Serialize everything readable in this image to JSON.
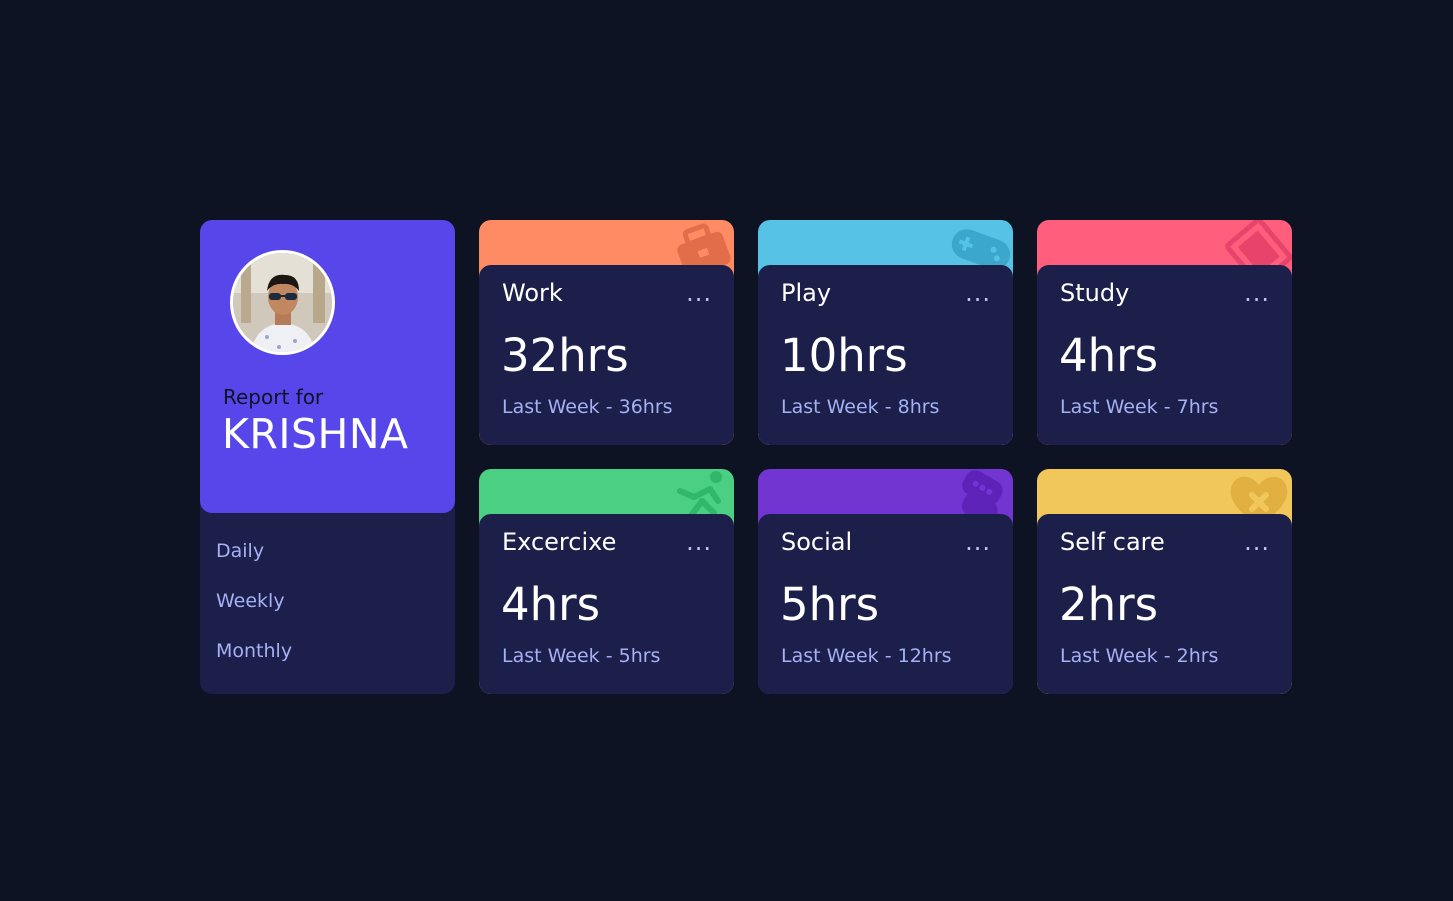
{
  "profile": {
    "report_label": "Report for",
    "name": "KRISHNA",
    "periods": [
      {
        "label": "Daily"
      },
      {
        "label": "Weekly"
      },
      {
        "label": "Monthly"
      }
    ]
  },
  "cards": [
    {
      "title": "Work",
      "current": "32hrs",
      "previous": "Last Week - 36hrs",
      "menu": "...",
      "color": "#ff8b64",
      "icon": "briefcase-icon"
    },
    {
      "title": "Play",
      "current": "10hrs",
      "previous": "Last Week - 8hrs",
      "menu": "...",
      "color": "#55c2e6",
      "icon": "gamepad-icon"
    },
    {
      "title": "Study",
      "current": "4hrs",
      "previous": "Last Week - 7hrs",
      "menu": "...",
      "color": "#ff5e7d",
      "icon": "book-icon"
    },
    {
      "title": "Excercixe",
      "current": "4hrs",
      "previous": "Last Week - 5hrs",
      "menu": "...",
      "color": "#4bcf82",
      "icon": "running-icon"
    },
    {
      "title": "Social",
      "current": "5hrs",
      "previous": "Last Week - 12hrs",
      "menu": "...",
      "color": "#7335d2",
      "icon": "chat-icon"
    },
    {
      "title": "Self care",
      "current": "2hrs",
      "previous": "Last Week - 2hrs",
      "menu": "...",
      "color": "#f1c75b",
      "icon": "heart-icon"
    }
  ],
  "colors": {
    "background": "#0e1323",
    "card_body": "#1c1f4a",
    "profile_accent": "#5747ea",
    "muted_text": "#a6b0f5"
  }
}
